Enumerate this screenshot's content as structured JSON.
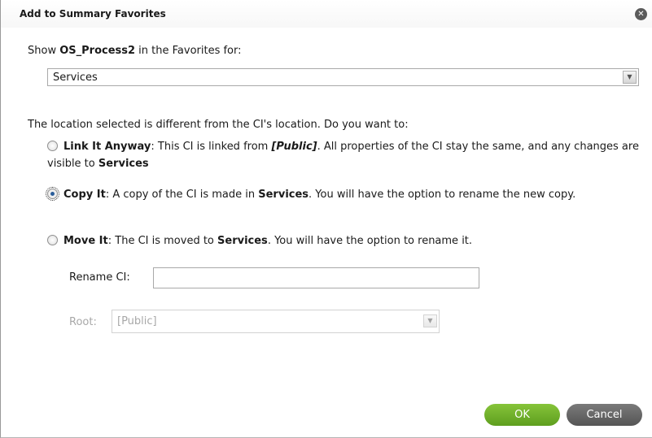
{
  "dialog": {
    "title": "Add to Summary Favorites",
    "close_icon": "close-icon"
  },
  "show_line": {
    "prefix": "Show ",
    "ci_name": "OS_Process2",
    "suffix": " in the Favorites for:"
  },
  "favorites_select": {
    "value": "Services"
  },
  "question": "The location selected is different from the CI's location.   Do you want to:",
  "options": [
    {
      "label": "Link It Anyway",
      "text1": ": This CI is linked from ",
      "location": "[Public]",
      "text2": ". All properties of the CI stay the same, and any changes are visible to ",
      "target": "Services",
      "text3": "",
      "checked": false
    },
    {
      "label": "Copy It",
      "text1": ": A copy of the CI is made in ",
      "target": "Services",
      "text2": ". You will have the option to rename the new copy.",
      "checked": true
    },
    {
      "label": "Move It",
      "text1": ": The CI is moved to ",
      "target": "Services",
      "text2": ". You will have the option to rename it.",
      "checked": false
    }
  ],
  "rename": {
    "label": "Rename CI:",
    "value": ""
  },
  "root": {
    "label": "Root:",
    "value": "[Public]",
    "disabled": true
  },
  "buttons": {
    "ok": "OK",
    "cancel": "Cancel"
  },
  "colors": {
    "ok": "#6fb12a",
    "cancel": "#666666",
    "radio_selected": "#2a5d9a"
  }
}
